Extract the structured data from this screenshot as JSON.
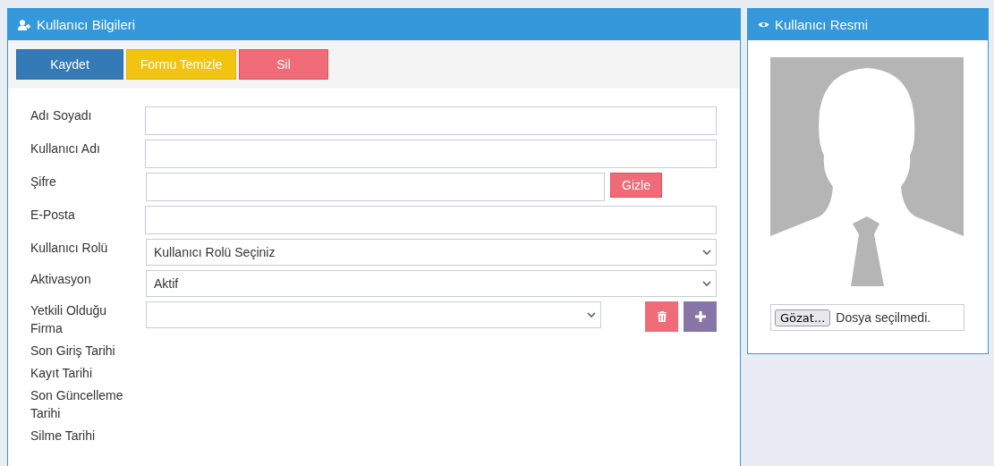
{
  "user_panel": {
    "title": "Kullanıcı Bilgileri",
    "buttons": [
      {
        "label": "Kaydet",
        "kind": "primary"
      },
      {
        "label": "Formu Temizle",
        "kind": "warning"
      },
      {
        "label": "Sil",
        "kind": "danger"
      }
    ],
    "fields": [
      {
        "label": "Adı Soyadı",
        "kind": "text"
      },
      {
        "label": "Kullanıcı Adı",
        "kind": "text"
      },
      {
        "label": "Şifre",
        "kind": "password",
        "button": "Gizle"
      },
      {
        "label": "E-Posta",
        "kind": "text"
      },
      {
        "label": "Kullanıcı Rolü",
        "kind": "select",
        "value": "Kullanıcı Rolü Seçiniz"
      },
      {
        "label": "Aktivasyon",
        "kind": "select",
        "value": "Aktif"
      },
      {
        "label": "Yetkili Olduğu Firma",
        "kind": "select_actions"
      },
      {
        "label": "Son Giriş Tarihi",
        "kind": "info"
      },
      {
        "label": "Kayıt Tarihi",
        "kind": "info"
      },
      {
        "label": "Son Güncelleme Tarihi",
        "kind": "info"
      },
      {
        "label": "Silme Tarihi",
        "kind": "info"
      }
    ]
  },
  "image_panel": {
    "title": "Kullanıcı Resmi",
    "file": {
      "button": "Gözat...",
      "status": "Dosya seçilmedi."
    }
  }
}
